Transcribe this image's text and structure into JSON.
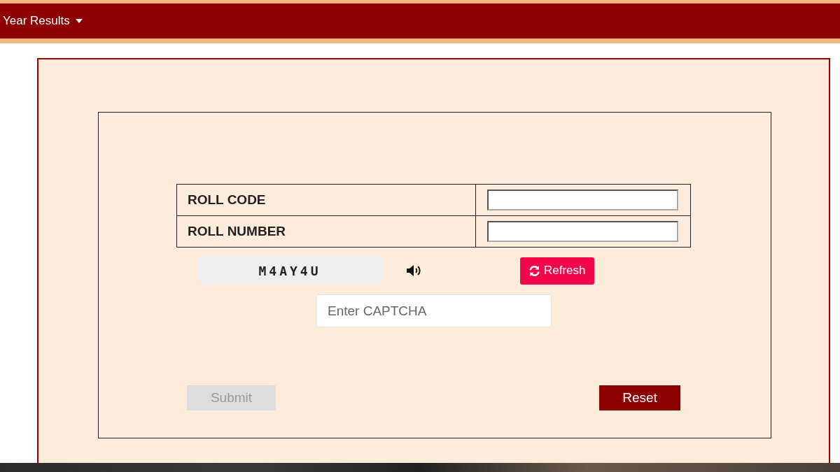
{
  "navbar": {
    "menu_label": "Year Results"
  },
  "form": {
    "fields": [
      {
        "label": "ROLL CODE"
      },
      {
        "label": "ROLL NUMBER"
      }
    ],
    "captcha": {
      "code": "M4AY4U",
      "refresh_label": "Refresh",
      "input_placeholder": "Enter CAPTCHA"
    },
    "buttons": [
      {
        "kind": "submit",
        "label": "Submit",
        "disabled": true
      },
      {
        "kind": "reset",
        "label": "Reset",
        "disabled": false
      }
    ]
  }
}
